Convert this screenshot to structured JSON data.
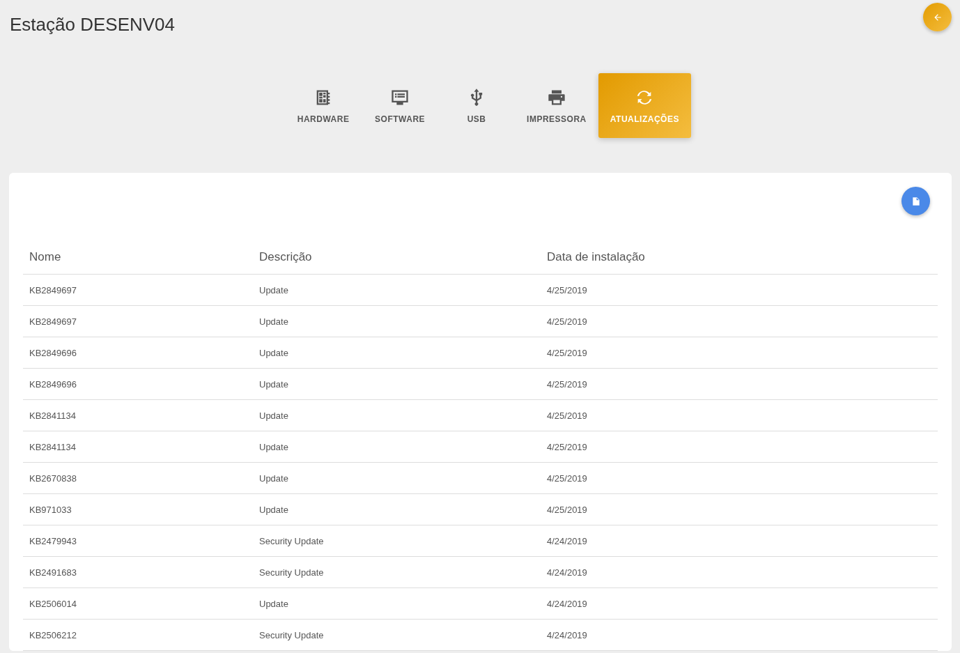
{
  "title": "Estação DESENV04",
  "tabs": [
    {
      "label": "HARDWARE",
      "kind": "hardware",
      "selected": false
    },
    {
      "label": "SOFTWARE",
      "kind": "software",
      "selected": false
    },
    {
      "label": "USB",
      "kind": "usb",
      "selected": false
    },
    {
      "label": "IMPRESSORA",
      "kind": "printer",
      "selected": false
    },
    {
      "label": "ATUALIZAÇÕES",
      "kind": "updates",
      "selected": true
    }
  ],
  "table": {
    "columns": [
      "Nome",
      "Descrição",
      "Data de instalação"
    ],
    "rows": [
      [
        "KB2849697",
        "Update",
        "4/25/2019"
      ],
      [
        "KB2849697",
        "Update",
        "4/25/2019"
      ],
      [
        "KB2849696",
        "Update",
        "4/25/2019"
      ],
      [
        "KB2849696",
        "Update",
        "4/25/2019"
      ],
      [
        "KB2841134",
        "Update",
        "4/25/2019"
      ],
      [
        "KB2841134",
        "Update",
        "4/25/2019"
      ],
      [
        "KB2670838",
        "Update",
        "4/25/2019"
      ],
      [
        "KB971033",
        "Update",
        "4/25/2019"
      ],
      [
        "KB2479943",
        "Security Update",
        "4/24/2019"
      ],
      [
        "KB2491683",
        "Security Update",
        "4/24/2019"
      ],
      [
        "KB2506014",
        "Update",
        "4/24/2019"
      ],
      [
        "KB2506212",
        "Security Update",
        "4/24/2019"
      ]
    ]
  }
}
